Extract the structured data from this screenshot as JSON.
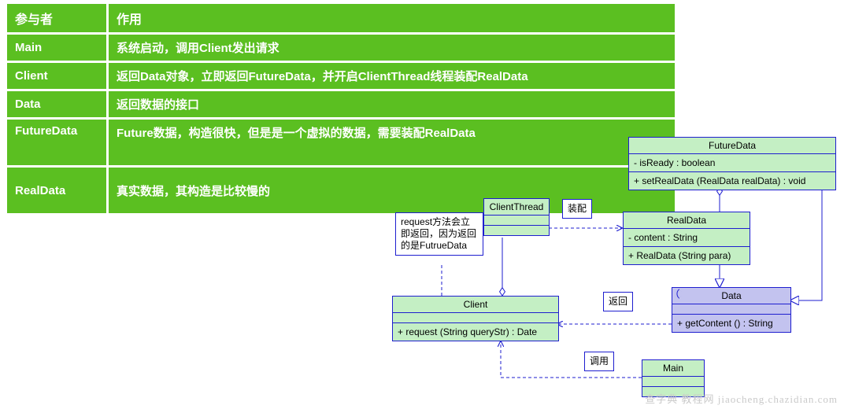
{
  "table": {
    "headers": [
      "参与者",
      "作用"
    ],
    "rows": [
      {
        "p": "Main",
        "r": "系统启动，调用Client发出请求"
      },
      {
        "p": "Client",
        "r": "返回Data对象，立即返回FutureData，并开启ClientThread线程装配RealData"
      },
      {
        "p": "Data",
        "r": "返回数据的接口"
      },
      {
        "p": "FutureData",
        "r": "Future数据，构造很快，但是是一个虚拟的数据，需要装配RealData"
      },
      {
        "p": "RealData",
        "r": "真实数据，其构造是比较慢的"
      }
    ]
  },
  "uml": {
    "classes": {
      "FutureData": {
        "name": "FutureData",
        "attrs": [
          "-  isReady   : boolean"
        ],
        "ops": [
          "+  setRealData (RealData realData)   : void"
        ]
      },
      "ClientThread": {
        "name": "ClientThread",
        "attrs": [],
        "ops": []
      },
      "RealData": {
        "name": "RealData",
        "attrs": [
          "-  content   : String"
        ],
        "ops": [
          "+  RealData (String para)"
        ]
      },
      "Client": {
        "name": "Client",
        "attrs": [],
        "ops": [
          "+  request (String queryStr)   : Date"
        ]
      },
      "Data": {
        "name": "Data",
        "attrs": [],
        "ops": [
          "+  getContent ()   : String"
        ]
      },
      "Main": {
        "name": "Main",
        "attrs": [],
        "ops": []
      }
    },
    "notes": {
      "request_note": "request方法会立即返回，因为返回的是FutrueData",
      "assemble": "装配",
      "return": "返回",
      "call": "调用"
    }
  },
  "watermark": "查字典  教程网  jiaocheng.chazidian.com"
}
